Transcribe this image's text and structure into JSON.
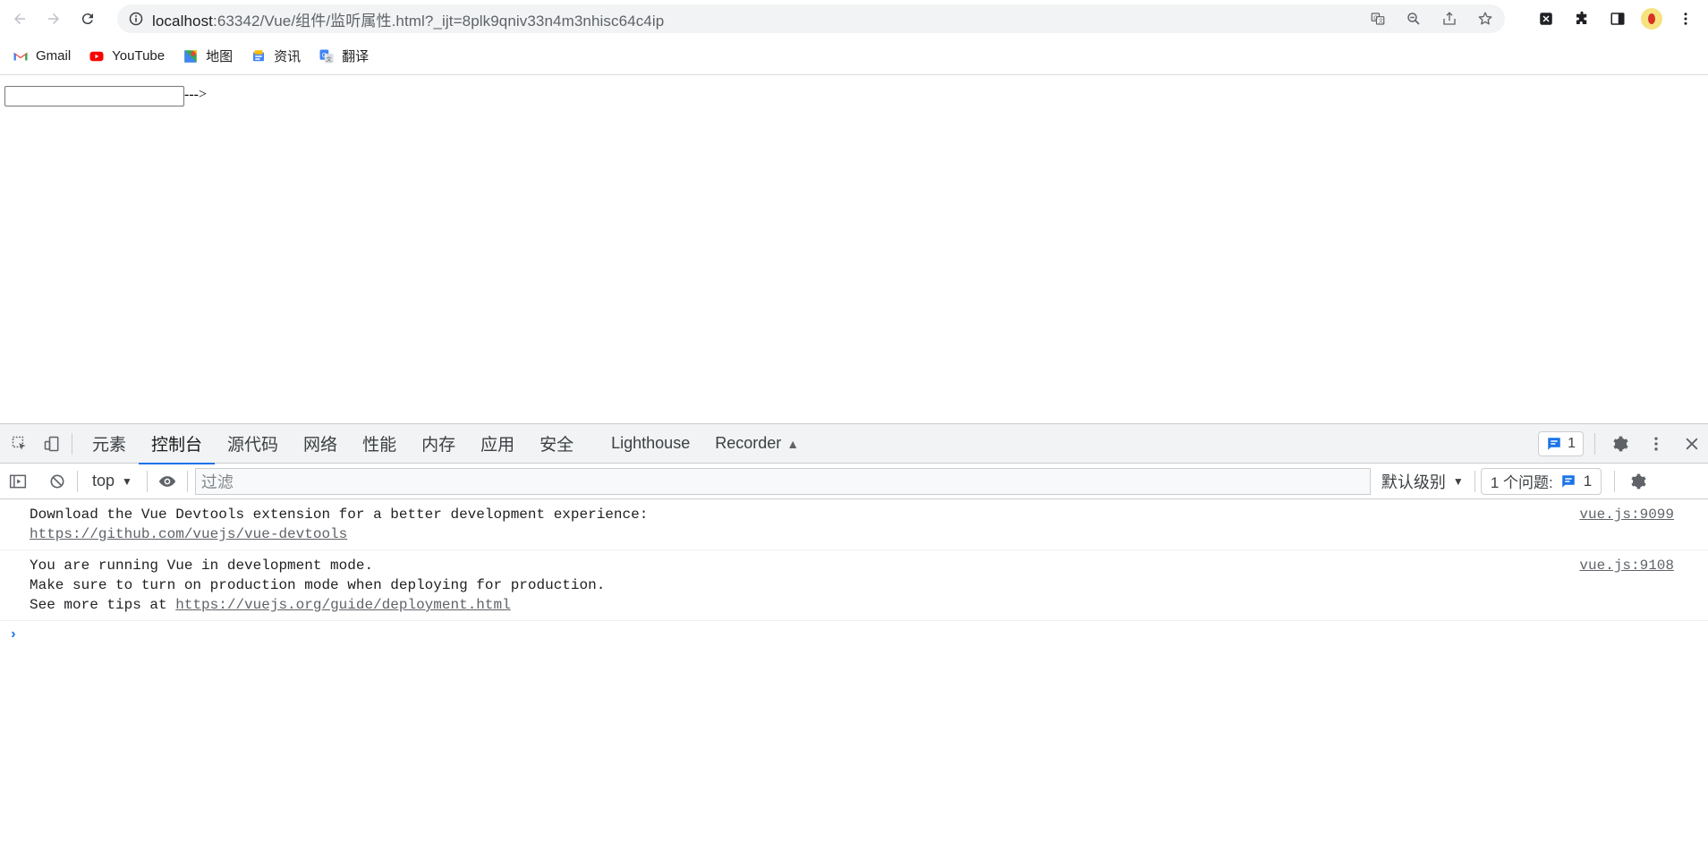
{
  "browser": {
    "url_host": "localhost",
    "url_path": ":63342/Vue/组件/监听属性.html?_ijt=8plk9qniv33n4m3nhisc64c4ip"
  },
  "bookmarks": [
    {
      "label": "Gmail",
      "icon": "gmail-icon"
    },
    {
      "label": "YouTube",
      "icon": "youtube-icon"
    },
    {
      "label": "地图",
      "icon": "maps-icon"
    },
    {
      "label": "资讯",
      "icon": "news-icon"
    },
    {
      "label": "翻译",
      "icon": "translate-icon"
    }
  ],
  "page": {
    "input_value": "",
    "arrow_text": "--->"
  },
  "devtools": {
    "tabs": [
      {
        "label": "元素"
      },
      {
        "label": "控制台",
        "active": true
      },
      {
        "label": "源代码"
      },
      {
        "label": "网络"
      },
      {
        "label": "性能"
      },
      {
        "label": "内存"
      },
      {
        "label": "应用"
      },
      {
        "label": "安全"
      },
      {
        "label": "Lighthouse"
      },
      {
        "label": "Recorder"
      }
    ],
    "message_badge_count": "1",
    "toolbar": {
      "context": "top",
      "filter_placeholder": "过滤",
      "level": "默认级别",
      "issues_label": "1 个问题:",
      "issues_count": "1"
    },
    "console": {
      "messages": [
        {
          "lines": [
            "Download the Vue Devtools extension for a better development experience:"
          ],
          "link": "https://github.com/vuejs/vue-devtools",
          "source": "vue.js:9099"
        },
        {
          "lines": [
            "You are running Vue in development mode.",
            "Make sure to turn on production mode when deploying for production."
          ],
          "link_prefix": "See more tips at ",
          "link": "https://vuejs.org/guide/deployment.html",
          "source": "vue.js:9108"
        }
      ],
      "prompt": "›"
    }
  },
  "colors": {
    "accent": "#1a73e8",
    "tab_underline": "#1a73e8"
  }
}
